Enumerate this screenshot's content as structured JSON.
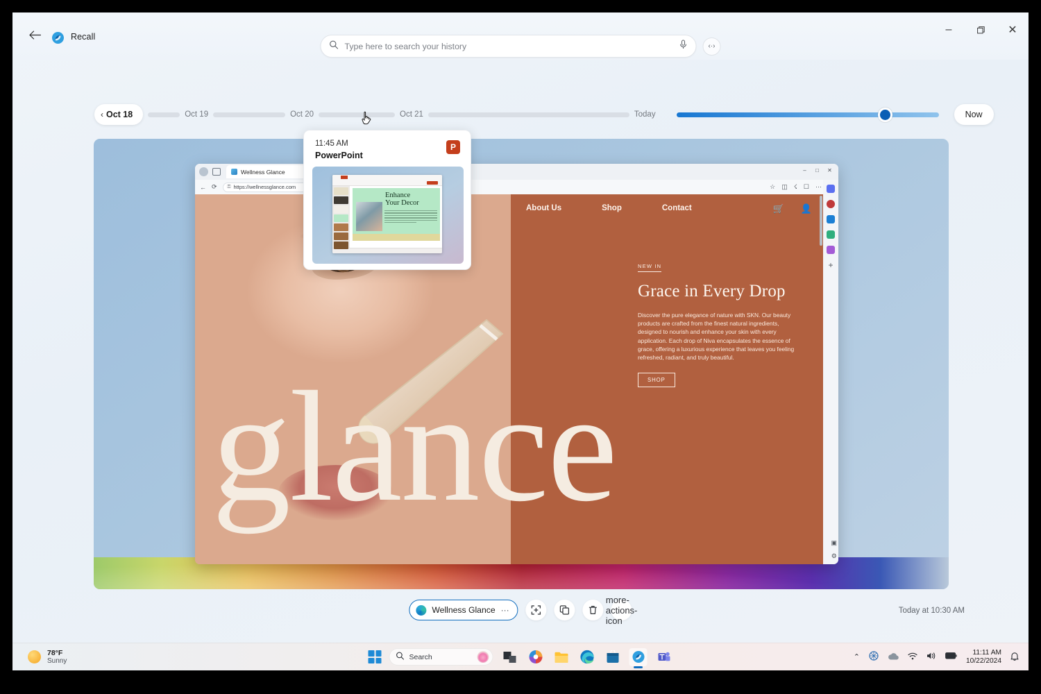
{
  "app": {
    "title": "Recall",
    "back_icon": "back-arrow-icon",
    "logo_icon": "recall-logo-icon"
  },
  "search": {
    "placeholder": "Type here to search your history",
    "search_icon": "search-icon",
    "mic_icon": "microphone-icon",
    "more_icon": "more-options-icon"
  },
  "window_controls": {
    "minimize": "–",
    "restore": "❐",
    "close": "✕"
  },
  "timeline": {
    "current_day": "Oct 18",
    "chevron": "‹",
    "labels": [
      "Oct 19",
      "Oct 20",
      "Oct 21",
      "Today"
    ],
    "now_label": "Now",
    "slider_value": 77
  },
  "preview": {
    "time": "11:45 AM",
    "app": "PowerPoint",
    "badge": "P",
    "slide_title_line1": "Enhance",
    "slide_title_line2": "Your Decor"
  },
  "snapshot": {
    "browser": {
      "tab_title": "Wellness Glance",
      "url": "https://wellnessglance.com",
      "close_tab": "✕",
      "back_icon": "←",
      "reload_icon": "⟳",
      "lock_icon": "🔒",
      "toolbar_icons": [
        "favorites-icon",
        "collections-icon",
        "split-screen-icon",
        "browser-essentials-icon",
        "settings-more-icon"
      ],
      "win_minimize": "–",
      "win_restore": "□",
      "win_close": "✕",
      "sidebar_icons": [
        "copilot-icon",
        "shopping-icon",
        "office-icon",
        "outlook-icon",
        "games-icon",
        "designer-icon",
        "add-icon"
      ]
    },
    "site": {
      "nav": [
        "About Us",
        "Shop",
        "Contact"
      ],
      "cart_icon": "shopping-cart-icon",
      "account_icon": "user-account-icon",
      "eyebrow": "NEW IN",
      "heading": "Grace in Every Drop",
      "body": "Discover the pure elegance of nature with SKN. Our beauty products are crafted from the finest natural ingredients, designed to nourish and enhance your skin with every application. Each drop of Niva encapsulates the essence of grace, offering a luxurious experience that leaves you feeling refreshed, radiant, and truly beautiful.",
      "cta": "SHOP"
    },
    "overlay_word": "glance"
  },
  "actionbar": {
    "app_name": "Wellness Glance",
    "app_more": "···",
    "snip_icon": "screenshot-select-icon",
    "copy_icon": "copy-icon",
    "delete_icon": "delete-trash-icon",
    "more_icon": "more-actions-icon",
    "timestamp": "Today at 10:30 AM"
  },
  "taskbar": {
    "weather_temp": "78°F",
    "weather_cond": "Sunny",
    "search_label": "Search",
    "apps": [
      "task-view",
      "copilot",
      "file-explorer",
      "edge",
      "microsoft-store",
      "recall",
      "teams"
    ],
    "tray": {
      "chevron": "⌃",
      "time": "11:11 AM",
      "date": "10/22/2024",
      "bell": "🔔"
    }
  },
  "colors": {
    "accent": "#0f6cbd",
    "hero_bg": "#b1603f",
    "cream": "#f5ece1"
  }
}
